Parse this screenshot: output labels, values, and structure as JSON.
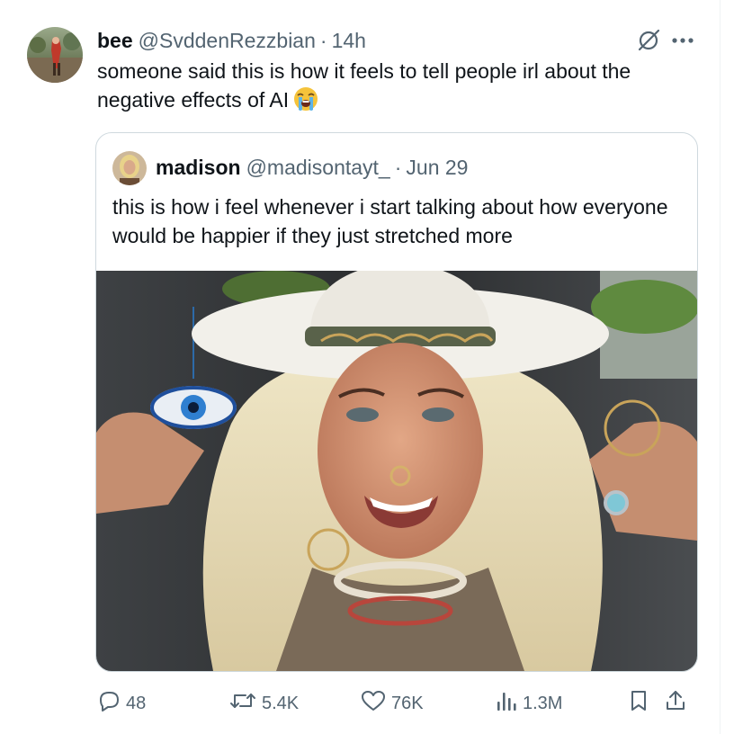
{
  "tweet": {
    "author_name": "bee",
    "author_handle": "@SvddenRezzbian",
    "separator": "·",
    "time": "14h",
    "text": "someone said this is how it feels to tell people irl about the negative effects of AI",
    "emoji": "loudly-crying-face"
  },
  "quoted_tweet": {
    "author_name": "madison",
    "author_handle": "@madisontayt_",
    "separator": "·",
    "date": "Jun 29",
    "text": "this is how i feel whenever i start talking about how everyone would be happier if they just stretched more"
  },
  "actions": {
    "replies": "48",
    "reposts": "5.4K",
    "likes": "76K",
    "views": "1.3M"
  },
  "icons": {
    "reply": "reply-icon",
    "repost": "repost-icon",
    "like": "heart-icon",
    "views": "views-icon",
    "bookmark": "bookmark-icon",
    "share": "share-icon",
    "grok": "grok-icon",
    "more": "more-icon"
  },
  "colors": {
    "text_primary": "#0f1419",
    "text_secondary": "#536471",
    "border": "#cfd9de"
  }
}
